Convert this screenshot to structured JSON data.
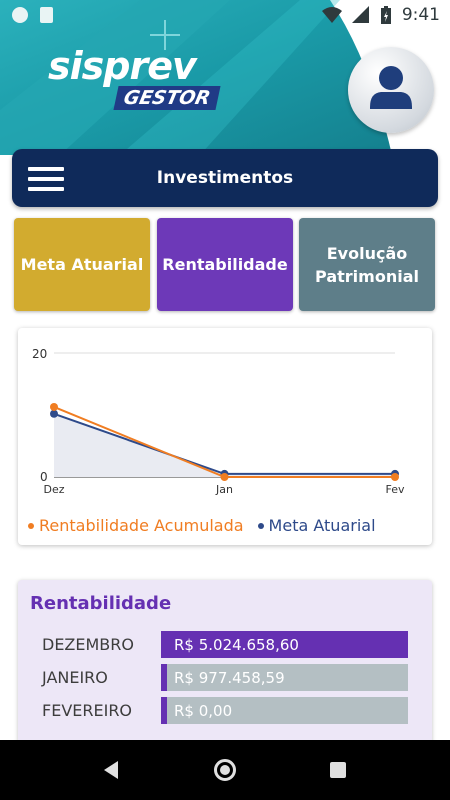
{
  "status_bar": {
    "time": "9:41"
  },
  "header": {
    "logo_main": "sisprev",
    "logo_sub": "GESTOR",
    "avatar_icon": "user-icon"
  },
  "nav": {
    "menu_icon": "hamburger-menu-icon",
    "title": "Investimentos"
  },
  "tabs": [
    {
      "label": "Meta Atuarial",
      "color": "#d2ab2f"
    },
    {
      "label": "Rentabilidade",
      "color": "#6d39b8"
    },
    {
      "label": "Evolução Patrimonial",
      "color": "#5e7e89"
    }
  ],
  "chart_data": {
    "type": "line",
    "categories": [
      "Dez",
      "Jan",
      "Fev"
    ],
    "ylim": [
      0,
      20
    ],
    "y_ticks": [
      "20",
      "0"
    ],
    "grid": true,
    "legend_position": "bottom",
    "series": [
      {
        "name": "Rentabilidade Acumulada",
        "values": [
          11.3,
          0,
          0
        ],
        "color": "#f07d22"
      },
      {
        "name": "Meta Atuarial",
        "values": [
          10.2,
          0.5,
          0.5
        ],
        "color": "#2e4a8a"
      }
    ]
  },
  "rentabilidade": {
    "title": "Rentabilidade",
    "rows": [
      {
        "month": "DEZEMBRO",
        "value": "R$  5.024.658,60",
        "fill": "#6530b2"
      },
      {
        "month": "JANEIRO",
        "value": "R$  977.458,59",
        "fill": "#b4bfc3"
      },
      {
        "month": "FEVEREIRO",
        "value": "R$  0,00",
        "fill": "#b4bfc3"
      }
    ]
  }
}
